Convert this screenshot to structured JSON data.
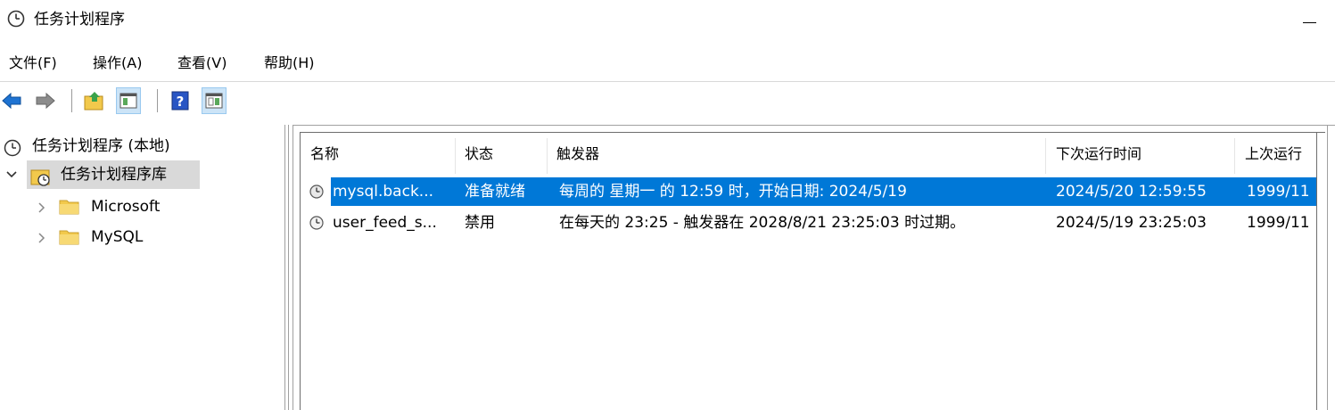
{
  "window": {
    "title": "任务计划程序"
  },
  "menu": [
    {
      "label": "文件(F)"
    },
    {
      "label": "操作(A)"
    },
    {
      "label": "查看(V)"
    },
    {
      "label": "帮助(H)"
    }
  ],
  "toolbar": {
    "buttons": [
      {
        "icon": "back-arrow-icon"
      },
      {
        "icon": "forward-arrow-icon"
      },
      {
        "icon": "up-folder-icon"
      },
      {
        "icon": "show-hide-console-tree-icon"
      },
      {
        "icon": "help-icon"
      },
      {
        "icon": "show-hide-action-pane-icon"
      }
    ]
  },
  "tree": {
    "root": {
      "label": "任务计划程序 (本地)"
    },
    "library": {
      "label": "任务计划程序库"
    },
    "folders": [
      {
        "label": "Microsoft"
      },
      {
        "label": "MySQL"
      }
    ]
  },
  "table": {
    "columns": [
      {
        "label": "名称"
      },
      {
        "label": "状态"
      },
      {
        "label": "触发器"
      },
      {
        "label": "下次运行时间"
      },
      {
        "label": "上次运行"
      }
    ],
    "rows": [
      {
        "name": "mysql.back...",
        "status": "准备就绪",
        "trigger": "每周的 星期一 的 12:59 时，开始日期: 2024/5/19",
        "next_run": "2024/5/20 12:59:55",
        "last_run": "1999/11",
        "selected": true
      },
      {
        "name": "user_feed_s...",
        "status": "禁用",
        "trigger": "在每天的 23:25 - 触发器在 2028/8/21 23:25:03 时过期。",
        "next_run": "2024/5/19 23:25:03",
        "last_run": "1999/11",
        "selected": false
      }
    ]
  },
  "colors": {
    "selection": "#0078d7",
    "tree_selection": "#d9d9d9",
    "folder": "#f2c94c",
    "back_arrow": "#1e73d2"
  }
}
